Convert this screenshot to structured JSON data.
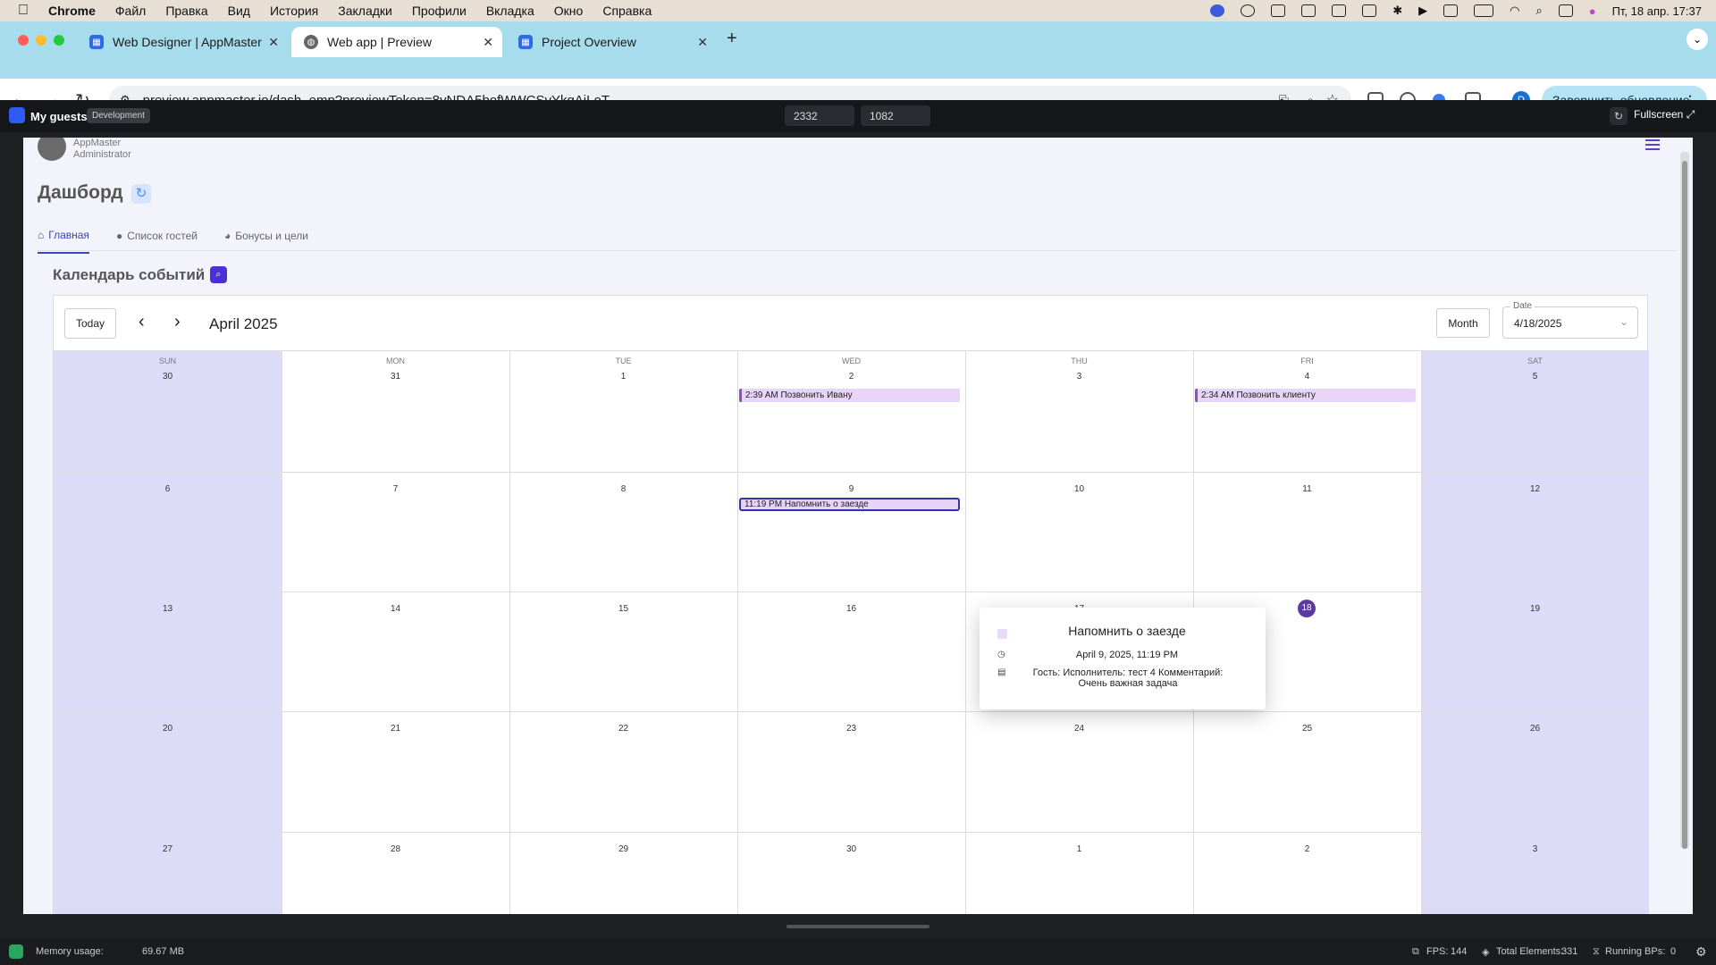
{
  "menubar": {
    "apple": "",
    "app": "Chrome",
    "items": [
      "Файл",
      "Правка",
      "Вид",
      "История",
      "Закладки",
      "Профили",
      "Вкладка",
      "Окно",
      "Справка"
    ],
    "clock": "Пт, 18 апр. 17:37"
  },
  "browser": {
    "tabs": [
      {
        "title": "Web Designer | AppMaster",
        "active": false
      },
      {
        "title": "Web app | Preview",
        "active": true
      },
      {
        "title": "Project Overview",
        "active": false
      }
    ],
    "new_tab": "+",
    "url": "preview.appmaster.io/dash_emp?previewToken=8yNDA5bofWWCSvYkqAiLoT",
    "profile_initial": "D",
    "update_label": "Завершить обновление"
  },
  "preview_bar": {
    "app_name": "My guests",
    "env_badge": "Development",
    "width_value": "2332",
    "height_value": "1082",
    "fullscreen_label": "Fullscreen"
  },
  "user": {
    "name": "AppMaster",
    "role": "Administrator"
  },
  "page": {
    "title": "Дашборд",
    "tabs": [
      {
        "label": "Главная",
        "active": true
      },
      {
        "label": "Список гостей",
        "active": false
      },
      {
        "label": "Бонусы и цели",
        "active": false
      }
    ]
  },
  "calendar": {
    "section_title": "Календарь событий",
    "today_label": "Today",
    "prev_label": "‹",
    "next_label": "›",
    "month_title": "April 2025",
    "view_label": "Month",
    "date_field_label": "Date",
    "date_field_value": "4/18/2025",
    "days_of_week": [
      "SUN",
      "MON",
      "TUE",
      "WED",
      "THU",
      "FRI",
      "SAT"
    ],
    "weeks": [
      [
        "30",
        "31",
        "1",
        "2",
        "3",
        "4",
        "5"
      ],
      [
        "6",
        "7",
        "8",
        "9",
        "10",
        "11",
        "12"
      ],
      [
        "13",
        "14",
        "15",
        "16",
        "17",
        "18",
        "19"
      ],
      [
        "20",
        "21",
        "22",
        "23",
        "24",
        "25",
        "26"
      ],
      [
        "27",
        "28",
        "29",
        "30",
        "1",
        "2",
        "3"
      ]
    ],
    "today_date": "18",
    "events": [
      {
        "label": "2:39 AM Позвонить Ивану",
        "week": 0,
        "day": 3,
        "selected": false
      },
      {
        "label": "2:34 AM Позвонить клиенту",
        "week": 0,
        "day": 5,
        "selected": false
      },
      {
        "label": "11:19 PM Напомнить о заезде",
        "week": 1,
        "day": 3,
        "selected": true
      }
    ],
    "popup": {
      "title": "Напомнить о заезде",
      "datetime": "April 9, 2025, 11:19 PM",
      "description": "Гость: Исполнитель: тест 4 Комментарий: Очень важная задача"
    }
  },
  "status_bar": {
    "memory_label": "Memory usage:",
    "memory_value": "69.67 MB",
    "fps_label": "FPS:",
    "fps_value": "144",
    "elements_label": "Total Elements:",
    "elements_value": "331",
    "bps_label": "Running BPs:",
    "bps_value": "0"
  },
  "colors": {
    "accent": "#3949ab",
    "weekend": "#dcdcf8",
    "event_bg": "#e8d4f6",
    "today": "#5b3c9e",
    "tabstrip": "#a7dcec"
  }
}
